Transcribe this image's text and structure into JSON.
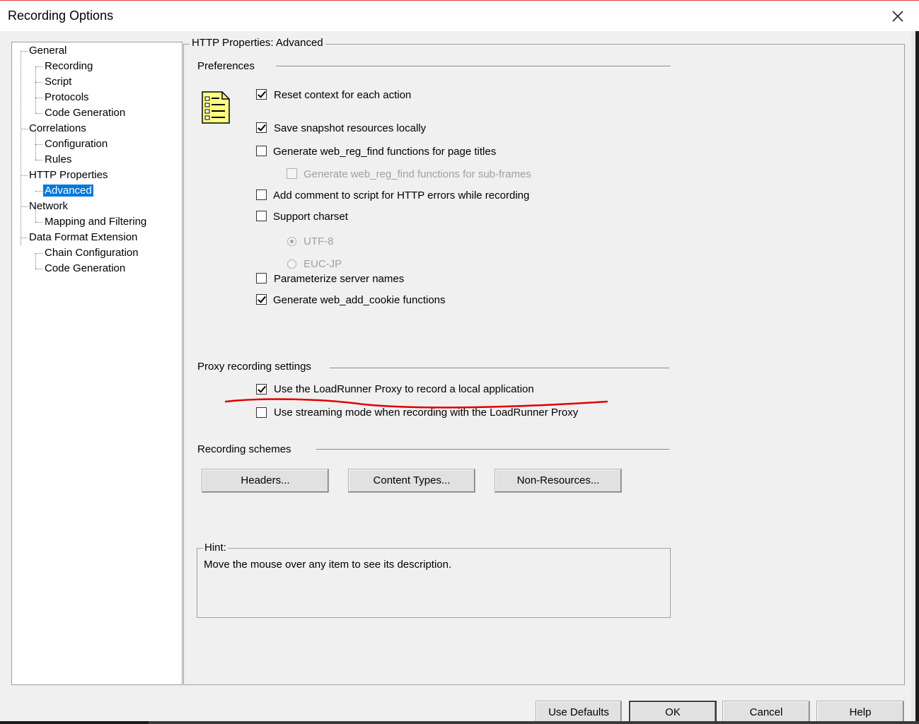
{
  "window": {
    "title": "Recording Options"
  },
  "tree": {
    "items": [
      {
        "label": "General"
      },
      {
        "label": "Recording"
      },
      {
        "label": "Script"
      },
      {
        "label": "Protocols"
      },
      {
        "label": "Code Generation"
      },
      {
        "label": "Correlations"
      },
      {
        "label": "Configuration"
      },
      {
        "label": "Rules"
      },
      {
        "label": "HTTP Properties"
      },
      {
        "label": "Advanced",
        "selected": true
      },
      {
        "label": "Network"
      },
      {
        "label": "Mapping and Filtering"
      },
      {
        "label": "Data Format Extension"
      },
      {
        "label": "Chain Configuration"
      },
      {
        "label": "Code Generation"
      }
    ]
  },
  "main": {
    "group_title": "HTTP Properties: Advanced",
    "preferences": {
      "label": "Preferences",
      "icon": "document-checklist-icon",
      "options": [
        {
          "label": "Reset context for each action",
          "checked": true,
          "enabled": true
        },
        {
          "label": "Save snapshot resources locally",
          "checked": true,
          "enabled": true
        },
        {
          "label": "Generate web_reg_find functions for page titles",
          "checked": false,
          "enabled": true
        },
        {
          "label": "Generate web_reg_find functions for sub-frames",
          "checked": false,
          "enabled": false
        },
        {
          "label": "Add comment to script for HTTP errors while recording",
          "checked": false,
          "enabled": true
        },
        {
          "label": "Support charset",
          "checked": false,
          "enabled": true
        },
        {
          "label": "Parameterize server names",
          "checked": false,
          "enabled": true
        },
        {
          "label": "Generate web_add_cookie functions",
          "checked": true,
          "enabled": true
        }
      ],
      "charset_options": [
        {
          "label": "UTF-8",
          "selected": true,
          "enabled": false
        },
        {
          "label": "EUC-JP",
          "selected": false,
          "enabled": false
        }
      ]
    },
    "proxy": {
      "label": "Proxy recording settings",
      "options": [
        {
          "label": "Use the LoadRunner Proxy to record a local application",
          "checked": true
        },
        {
          "label": "Use streaming mode when recording with the LoadRunner Proxy",
          "checked": false
        }
      ],
      "annotation_color": "#e00000"
    },
    "schemes": {
      "label": "Recording schemes",
      "buttons": [
        "Headers...",
        "Content Types...",
        "Non-Resources..."
      ]
    },
    "hint": {
      "label": "Hint:",
      "text": "Move the mouse over any item to see its description."
    }
  },
  "footer": {
    "buttons": [
      "Use Defaults",
      "OK",
      "Cancel",
      "Help"
    ]
  }
}
